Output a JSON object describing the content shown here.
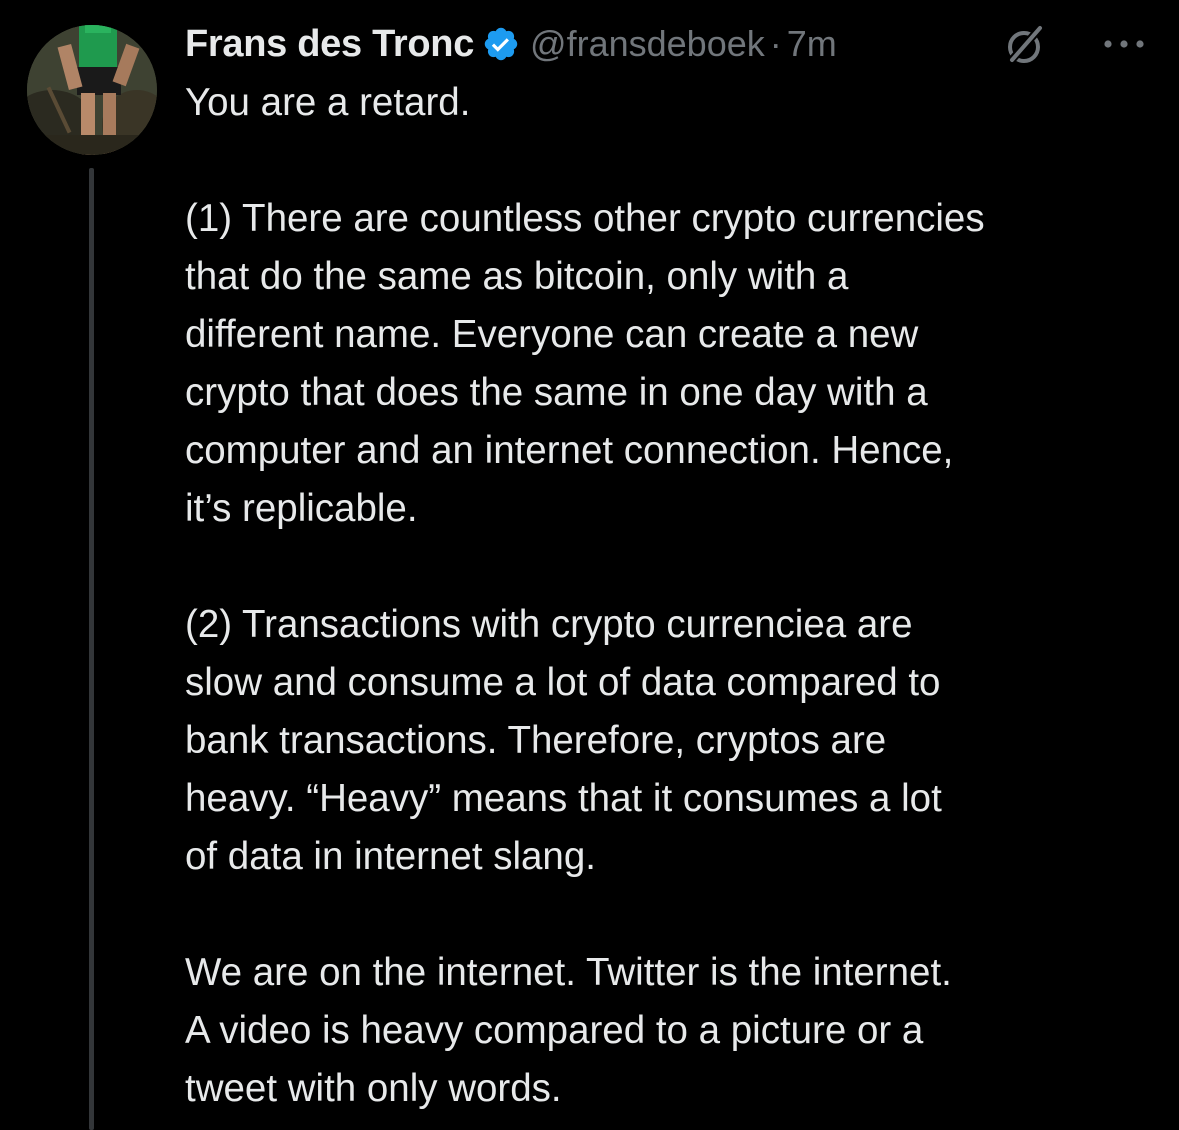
{
  "tweet": {
    "author": {
      "display_name": "Frans des Tronc",
      "handle": "@fransdeboek",
      "verified": true
    },
    "separator": "·",
    "time": "7m",
    "body_lines": [
      "You are a retard.",
      "",
      "(1) There are countless other crypto currencies",
      "that do the same as bitcoin, only with a",
      "different name. Everyone can create a new",
      "crypto that does the same in one day with a",
      "computer and an internet connection. Hence,",
      "it’s replicable.",
      "",
      "(2) Transactions with crypto currenciea are",
      "slow and consume a lot of data compared to",
      "bank transactions. Therefore, cryptos are",
      "heavy. “Heavy” means that it consumes a lot",
      "of data in internet slang.",
      "",
      "We are on the internet. Twitter is the internet.",
      "A video is heavy compared to a picture or a",
      "tweet with only words."
    ]
  },
  "icons": {
    "verified": "verified-badge-icon",
    "grok": "grok-icon",
    "more": "more-options-icon"
  },
  "colors": {
    "background": "#000000",
    "text": "#e7e9ea",
    "secondary": "#71767b",
    "verified": "#1d9bf0",
    "thread_line": "#333639"
  }
}
